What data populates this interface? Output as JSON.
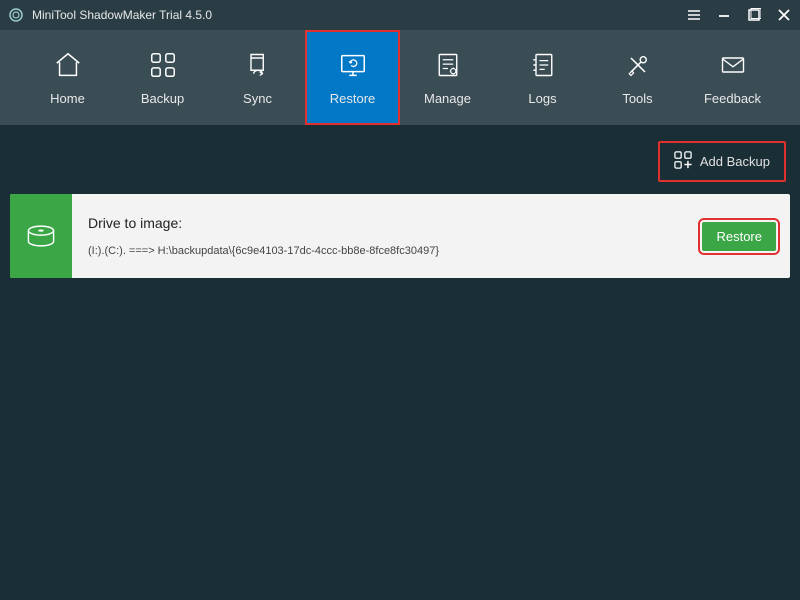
{
  "titlebar": {
    "title": "MiniTool ShadowMaker Trial 4.5.0"
  },
  "nav": {
    "items": [
      {
        "label": "Home"
      },
      {
        "label": "Backup"
      },
      {
        "label": "Sync"
      },
      {
        "label": "Restore"
      },
      {
        "label": "Manage"
      },
      {
        "label": "Logs"
      },
      {
        "label": "Tools"
      },
      {
        "label": "Feedback"
      }
    ],
    "active_index": 3
  },
  "toolbar": {
    "add_backup_label": "Add Backup"
  },
  "entry": {
    "title": "Drive to image:",
    "path": "(I:).(C:). ===> H:\\backupdata\\{6c9e4103-17dc-4ccc-bb8e-8fce8fc30497}",
    "restore_label": "Restore"
  },
  "colors": {
    "accent": "#0278c6",
    "success": "#3aa646",
    "highlight": "#e03030",
    "bg_dark": "#1a2e36",
    "bg_nav": "#3a4c54"
  }
}
